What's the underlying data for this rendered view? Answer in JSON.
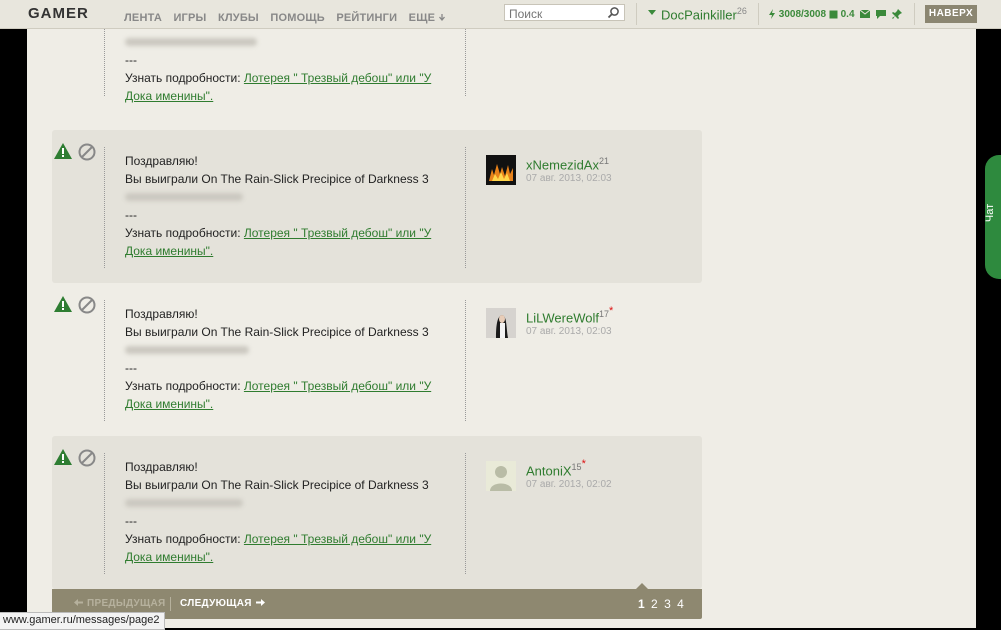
{
  "topbar": {
    "logo": "GAMER",
    "nav": [
      "ЛЕНТА",
      "ИГРЫ",
      "КЛУБЫ",
      "ПОМОЩЬ",
      "РЕЙТИНГИ",
      "ЕЩЕ"
    ],
    "search_placeholder": "Поиск",
    "username": "DocPainkiller",
    "user_level": "26",
    "energy": "3008/3008",
    "gold": "0.4",
    "top_button": "НАВЕРХ"
  },
  "messages": [
    {
      "partial": true,
      "sep": "---",
      "details_label": "Узнать подробности:",
      "link1": "Лотерея \" Трезвый дебош\" или \"У",
      "link2": "Дока именины\"."
    },
    {
      "greeting": "Поздравляю!",
      "won": "Вы выиграли On The Rain-Slick Precipice of Darkness 3",
      "sep": "---",
      "details_label": "Узнать подробности:",
      "link1": "Лотерея \" Трезвый дебош\" или \"У",
      "link2": "Дока именины\".",
      "author": "xNemezidAx",
      "author_level": "21",
      "date": "07 авг. 2013, 02:03"
    },
    {
      "greeting": "Поздравляю!",
      "won": "Вы выиграли On The Rain-Slick Precipice of Darkness 3",
      "sep": "---",
      "details_label": "Узнать подробности:",
      "link1": "Лотерея \" Трезвый дебош\" или \"У",
      "link2": "Дока именины\".",
      "author": "LiLWereWolf",
      "author_level": "17",
      "date": "07 авг. 2013, 02:03"
    },
    {
      "greeting": "Поздравляю!",
      "won": "Вы выиграли On The Rain-Slick Precipice of Darkness 3",
      "sep": "---",
      "details_label": "Узнать подробности:",
      "link1": "Лотерея \" Трезвый дебош\" или \"У",
      "link2": "Дока именины\".",
      "author": "AntoniX",
      "author_level": "15",
      "date": "07 авг. 2013, 02:02"
    }
  ],
  "pager": {
    "prev": "ПРЕДЫДУЩАЯ",
    "next": "СЛЕДУЮЩАЯ",
    "pages": [
      "1",
      "2",
      "3",
      "4"
    ],
    "current": "1"
  },
  "chat_tab": "Чат",
  "status_url": "www.gamer.ru/messages/page2",
  "colors": {
    "accent_green": "#2f7c2f",
    "pager_bg": "#8e8870",
    "chat_tab": "#2e8a3e"
  }
}
